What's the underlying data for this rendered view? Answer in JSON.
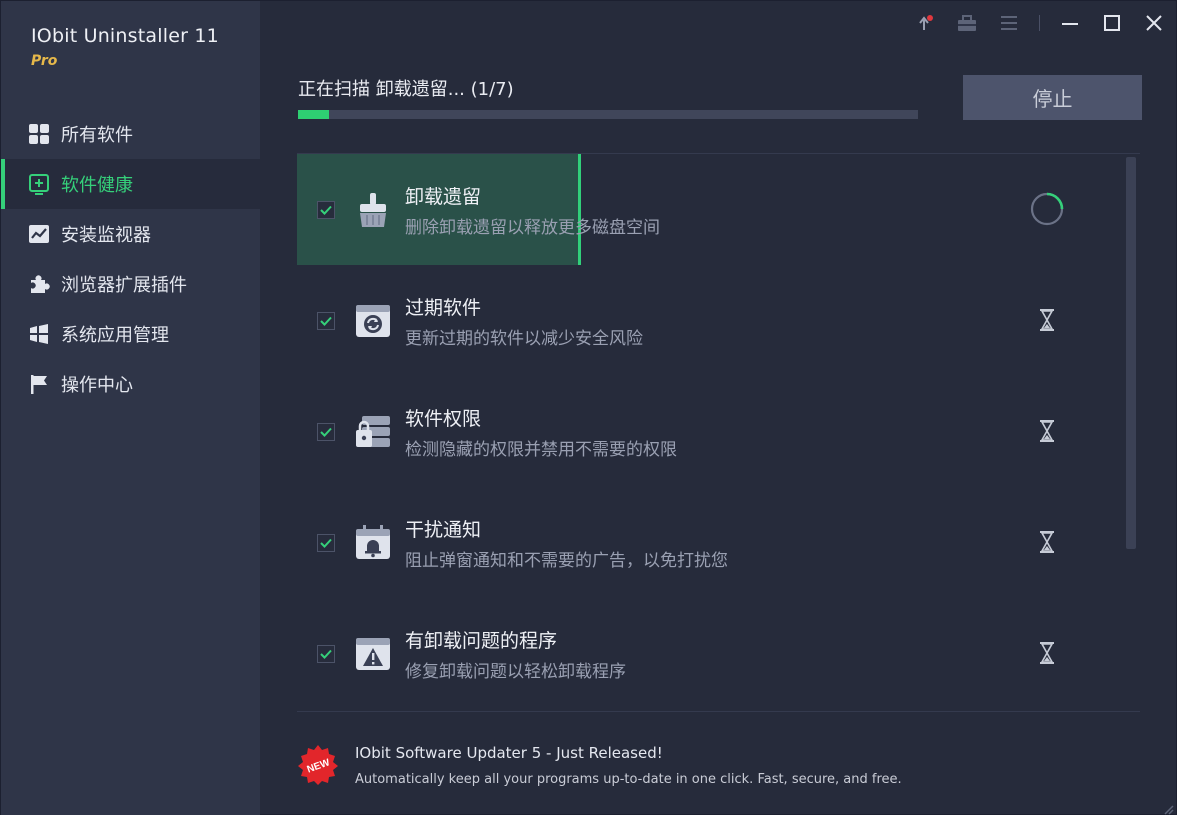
{
  "app": {
    "title": "IObit Uninstaller 11",
    "edition": "Pro"
  },
  "sidebar": {
    "items": [
      {
        "label": "所有软件",
        "icon": "grid-icon",
        "active": false
      },
      {
        "label": "软件健康",
        "icon": "health-plus-icon",
        "active": true
      },
      {
        "label": "安装监视器",
        "icon": "monitor-chart-icon",
        "active": false
      },
      {
        "label": "浏览器扩展插件",
        "icon": "puzzle-icon",
        "active": false
      },
      {
        "label": "系统应用管理",
        "icon": "windows-logo-icon",
        "active": false
      },
      {
        "label": "操作中心",
        "icon": "flag-icon",
        "active": false
      }
    ]
  },
  "window_controls": [
    "notification-icon",
    "toolbox-icon",
    "menu-icon",
    "minimize-icon",
    "maximize-icon",
    "close-icon"
  ],
  "scan": {
    "title": "正在扫描 卸载遗留... (1/7)",
    "progress": 0.05,
    "stop_label": "停止"
  },
  "tasks": [
    {
      "title": "卸载遗留",
      "subtitle": "删除卸载遗留以释放更多磁盘空间",
      "icon": "broom-icon",
      "checked": true,
      "status": "scanning"
    },
    {
      "title": "过期软件",
      "subtitle": "更新过期的软件以减少安全风险",
      "icon": "update-window-icon",
      "checked": true,
      "status": "waiting"
    },
    {
      "title": "软件权限",
      "subtitle": "检测隐藏的权限并禁用不需要的权限",
      "icon": "lock-server-icon",
      "checked": true,
      "status": "waiting"
    },
    {
      "title": "干扰通知",
      "subtitle": "阻止弹窗通知和不需要的广告，以免打扰您",
      "icon": "bell-calendar-icon",
      "checked": true,
      "status": "waiting"
    },
    {
      "title": "有卸载问题的程序",
      "subtitle": "修复卸载问题以轻松卸载程序",
      "icon": "warning-window-icon",
      "checked": true,
      "status": "waiting"
    }
  ],
  "footer": {
    "badge": "NEW",
    "title": "IObit Software Updater 5 - Just Released!",
    "subtitle": "Automatically keep all your programs up-to-date in one click. Fast, secure, and free."
  },
  "colors": {
    "accent": "#35d07a",
    "pro": "#e6b84a",
    "sidebar_bg": "#2f3548",
    "main_bg": "#262b3b"
  }
}
